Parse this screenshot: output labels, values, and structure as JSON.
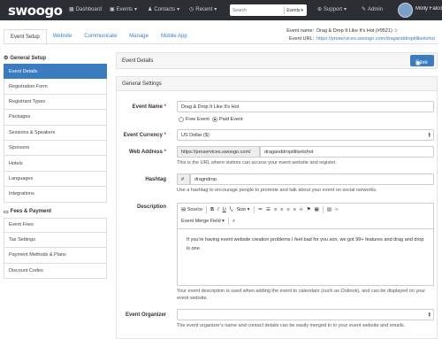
{
  "nav": {
    "logo": "swoogo",
    "dashboard": "Dashboard",
    "events": "Events",
    "contacts": "Contacts",
    "recent": "Recent",
    "search_placeholder": "Search",
    "search_scope": "Events",
    "support": "Support",
    "admin": "Admin",
    "user": "Molly Falco"
  },
  "tabs": [
    "Event Setup",
    "Website",
    "Communicate",
    "Manage",
    "Mobile App"
  ],
  "event": {
    "name_label": "Event name:",
    "name_value": "Drag & Drop It Like It's Hot (#9521) ☆",
    "url_label": "Event URL:",
    "url_value": "https://proservices.swoogo.com/draganddropitlikeitshot"
  },
  "sidebar": {
    "general_title": "General Setup",
    "general_items": [
      "Event Details",
      "Registration Form",
      "Registrant Types",
      "Packages",
      "Sessions & Speakers",
      "Sponsors",
      "Hotels",
      "Languages",
      "Integrations"
    ],
    "fees_title": "Fees & Payment",
    "fees_items": [
      "Event Fees",
      "Tax Settings",
      "Payment Methods & Plans",
      "Discount Codes"
    ]
  },
  "panel": {
    "title": "Event Details",
    "save": "Save"
  },
  "settings": {
    "title": "General Settings",
    "event_name_label": "Event Name",
    "event_name_value": "Drag & Drop It Like It's Hot",
    "free_event": "Free Event",
    "paid_event": "Paid Event",
    "currency_label": "Event Currency",
    "currency_value": "US Dollar ($)",
    "web_label": "Web Address",
    "web_prefix": "https://proservices.swoogo.com/",
    "web_value": "draganddropitlikeitshot",
    "web_help": "This is the URL where visitors can access your event website and register.",
    "hashtag_label": "Hashtag",
    "hashtag_symbol": "#",
    "hashtag_value": "dragndrop",
    "hashtag_help": "Use a hashtag to encourage people to promote and talk about your event on social networks.",
    "desc_label": "Description",
    "desc_source": "Source",
    "desc_size": "Size",
    "desc_merge": "Event Merge Field",
    "desc_text": "If you're having event website creation problems I feel bad for you son, we got 99+ features and drag and drop is one.",
    "desc_help": "Your event description is used when adding the event to calendars (such as Outlook), and can be displayed on your event website.",
    "organizer_label": "Event Organizer",
    "organizer_help": "The event organizer's name and contact details can be easily merged in to your event website and emails."
  },
  "colors": {
    "primary": "#3a7cbf",
    "nav_bg": "#2b2f33"
  }
}
